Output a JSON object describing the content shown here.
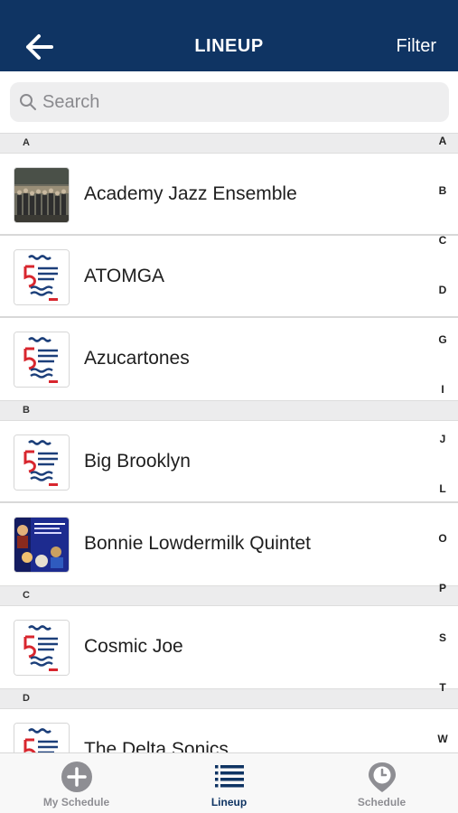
{
  "header": {
    "back_icon": "arrow-left-icon",
    "title": "LINEUP",
    "filter_label": "Filter"
  },
  "search": {
    "placeholder": "Search",
    "value": "",
    "icon": "search-icon"
  },
  "sections": [
    {
      "letter": "A",
      "items": [
        {
          "name": "Academy Jazz Ensemble",
          "thumb": "band-photo"
        },
        {
          "name": "ATOMGA",
          "thumb": "five-points-jazz-logo"
        },
        {
          "name": "Azucartones",
          "thumb": "five-points-jazz-logo"
        }
      ]
    },
    {
      "letter": "B",
      "items": [
        {
          "name": "Big Brooklyn",
          "thumb": "five-points-jazz-logo"
        },
        {
          "name": "Bonnie Lowdermilk Quintet",
          "thumb": "quintet-poster"
        }
      ]
    },
    {
      "letter": "C",
      "items": [
        {
          "name": "Cosmic Joe",
          "thumb": "five-points-jazz-logo"
        }
      ]
    },
    {
      "letter": "D",
      "items": [
        {
          "name": "The Delta Sonics",
          "thumb": "five-points-jazz-logo"
        }
      ]
    }
  ],
  "index_letters": [
    "A",
    "B",
    "C",
    "D",
    "G",
    "I",
    "J",
    "L",
    "O",
    "P",
    "S",
    "T",
    "W"
  ],
  "tabs": [
    {
      "label": "My Schedule",
      "icon": "plus-circle-icon",
      "active": false
    },
    {
      "label": "Lineup",
      "icon": "list-icon",
      "active": true
    },
    {
      "label": "Schedule",
      "icon": "map-pin-clock-icon",
      "active": false
    }
  ],
  "colors": {
    "header_bg": "#0f3463",
    "active_tab": "#0f3463",
    "inactive_tab": "#8e8e93"
  }
}
